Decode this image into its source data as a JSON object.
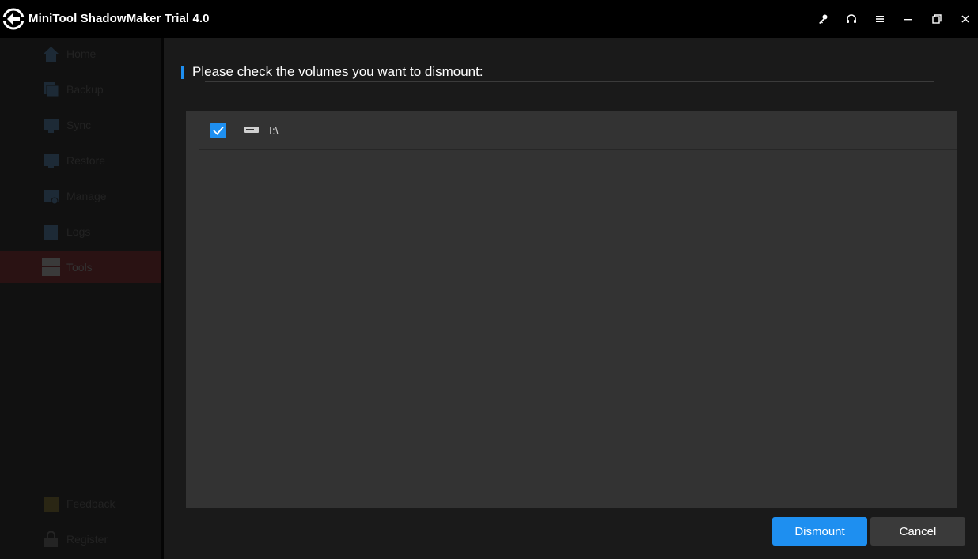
{
  "window": {
    "title": "MiniTool ShadowMaker Trial 4.0",
    "controls": [
      "key-icon",
      "headset-icon",
      "menu-icon",
      "minimize-icon",
      "restore-icon",
      "close-icon"
    ]
  },
  "sidebar": {
    "items": [
      {
        "label": "Home",
        "icon": "home-icon"
      },
      {
        "label": "Backup",
        "icon": "backup-icon"
      },
      {
        "label": "Sync",
        "icon": "sync-icon"
      },
      {
        "label": "Restore",
        "icon": "restore-icon"
      },
      {
        "label": "Manage",
        "icon": "manage-icon"
      },
      {
        "label": "Logs",
        "icon": "logs-icon"
      },
      {
        "label": "Tools",
        "icon": "tools-icon",
        "active": true
      }
    ],
    "bottom": [
      {
        "label": "Feedback",
        "icon": "feedback-icon"
      },
      {
        "label": "Register",
        "icon": "lock-icon"
      }
    ]
  },
  "dialog": {
    "heading": "Please check the volumes you want to dismount:",
    "volumes": [
      {
        "label": "I:\\",
        "checked": true,
        "icon": "drive-icon"
      }
    ],
    "buttons": {
      "dismount": "Dismount",
      "cancel": "Cancel"
    }
  },
  "colors": {
    "accent": "#1e8ff0",
    "panel": "#333333",
    "background": "#1a1a1a"
  }
}
